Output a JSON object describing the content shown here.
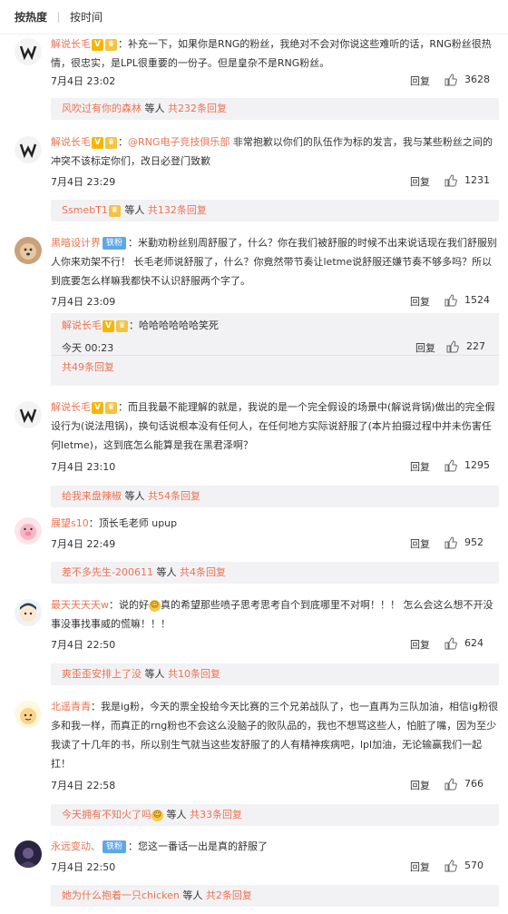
{
  "sort": {
    "hot": "按热度",
    "time": "按时间"
  },
  "labels": {
    "reply": "回复",
    "more_people": "等人",
    "count_prefix": "共",
    "count_suffix": "条回复"
  },
  "comments": [
    {
      "user": "解说长毛",
      "text": "：补充一下，如果你是RNG的粉丝，我绝对不会对你说这些难听的话，RNG粉丝很热情，很忠实，是LPL很重要的一份子。但是皇杂不是RNG粉丝。",
      "time": "7月4日 23:02",
      "likes": "3628",
      "reply_from": "风吹过有你的森林",
      "reply_count": "232"
    },
    {
      "user": "解说长毛",
      "mention": "@RNG电子竞技俱乐部",
      "text": " 非常抱歉以你们的队伍作为标的发言，我与某些粉丝之间的冲突不该标定你们，改日必登门致歉",
      "time": "7月4日 23:29",
      "likes": "1231",
      "reply_from": "SsmebT1",
      "reply_count": "132"
    },
    {
      "user": "黑暗设计界",
      "tag": "铁粉",
      "text": "：米勤劝粉丝别周舒服了，什么？你在我们被舒服的时候不出来说话现在我们舒服别人你来劝架不行！ 长毛老师说舒服了，什么？你竟然带节奏让letme说舒服还嫌节奏不够多吗？所以到底要怎么样嘛我都快不认识舒服两个字了。",
      "time": "7月4日 23:09",
      "likes": "1524",
      "sub": {
        "user": "解说长毛",
        "text": "：哈哈哈哈哈哈笑死",
        "time": "今天 00:23",
        "likes": "227"
      },
      "reply_count": "49"
    },
    {
      "user": "解说长毛",
      "text": "：而且我最不能理解的就是，我说的是一个完全假设的场景中(解说背锅)做出的完全假设行为(说法甩锅)，换句话说根本没有任何人，在任何地方实际说舒服了(本片拍摄过程中并未伤害任何letme)，这到底怎么能算是我在黑君泽啊？",
      "time": "7月4日 23:10",
      "likes": "1295",
      "reply_from": "给我来盘辣椒",
      "reply_count": "54"
    },
    {
      "user": "展望s10",
      "text": "：顶长毛老师 upup",
      "time": "7月4日 22:49",
      "likes": "952",
      "reply_from": "差不多先生-200611",
      "reply_count": "4"
    },
    {
      "user": "最天天天天w",
      "text_a": "：说的好",
      "text_b": "真的希望那些喷子思考思考自个到底哪里不对啊！！！ 怎么会这么想不开没事没事找事威的慌嘛！！！",
      "time": "7月4日 22:50",
      "likes": "624",
      "reply_from": "爽歪歪安排上了没",
      "reply_count": "10"
    },
    {
      "user": "北遥青青",
      "text": "：我是ig粉，今天的票全投给今天比赛的三个兄弟战队了，也一直再为三队加油，相信ig粉很多和我一样，而真正的rng粉也不会这么没脑子的败队品的，我也不想骂这些人，怕脏了嘴，因为至少我读了十几年的书，所以别生气就当这些发舒服了的人有精神疾病吧，lpl加油，无论输赢我们一起扛！",
      "time": "7月4日 22:58",
      "likes": "766",
      "reply_from": "今天拥有不知火了吗",
      "reply_count": "33"
    },
    {
      "user": "永远变动、",
      "tag": "铁粉",
      "text": "：您这一番话一出是真的舒服了",
      "time": "7月4日 22:50",
      "likes": "570",
      "reply_from": "她为什么抱着一只chicken",
      "reply_count": "2"
    }
  ]
}
